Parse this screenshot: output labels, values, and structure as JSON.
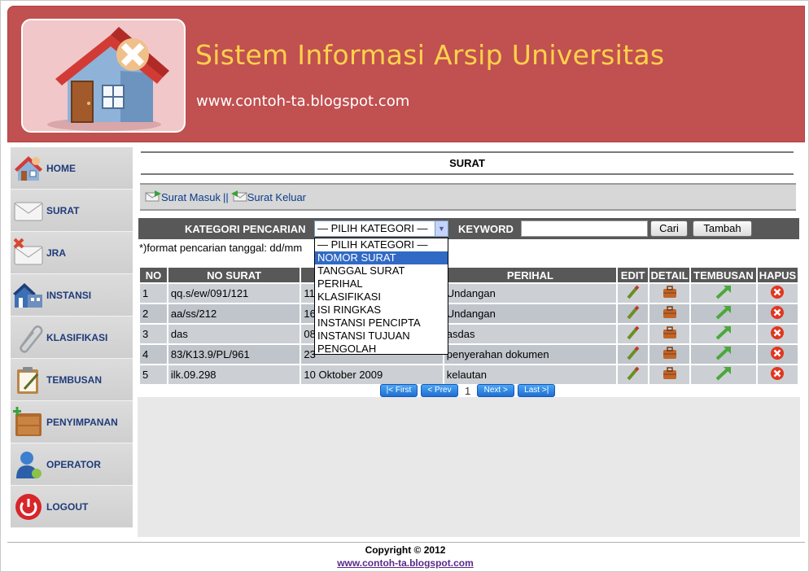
{
  "header": {
    "title": "Sistem Informasi Arsip Universitas",
    "url": "www.contoh-ta.blogspot.com"
  },
  "sidebar": {
    "items": [
      {
        "label": "HOME",
        "icon": "house-icon"
      },
      {
        "label": "SURAT",
        "icon": "envelope-icon"
      },
      {
        "label": "JRA",
        "icon": "envelope-delete-icon"
      },
      {
        "label": "INSTANSI",
        "icon": "building-icon"
      },
      {
        "label": "KLASIFIKASI",
        "icon": "paperclip-icon"
      },
      {
        "label": "TEMBUSAN",
        "icon": "clipboard-icon"
      },
      {
        "label": "PENYIMPANAN",
        "icon": "cabinet-icon"
      },
      {
        "label": "OPERATOR",
        "icon": "user-icon"
      },
      {
        "label": "LOGOUT",
        "icon": "power-icon"
      }
    ]
  },
  "main": {
    "page_title": "SURAT",
    "links": {
      "surat_masuk": "Surat Masuk",
      "separator": "||",
      "surat_keluar": "Surat Keluar"
    },
    "search": {
      "kategori_label": "KATEGORI PENCARIAN",
      "kategori_selected": "— PILIH KATEGORI —",
      "keyword_label": "KEYWORD",
      "keyword_value": "",
      "cari_button": "Cari",
      "tambah_button": "Tambah"
    },
    "format_hint": "*)format pencarian tanggal: dd/mm",
    "dropdown_options": [
      "— PILIH KATEGORI —",
      "NOMOR SURAT",
      "TANGGAL SURAT",
      "PERIHAL",
      "KLASIFIKASI",
      "ISI RINGKAS",
      "INSTANSI PENCIPTA",
      "INSTANSI TUJUAN",
      "PENGOLAH"
    ],
    "dropdown_highlighted": "NOMOR SURAT",
    "table": {
      "headers": [
        "NO",
        "NO SURAT",
        "",
        "PERIHAL",
        "EDIT",
        "DETAIL",
        "TEMBUSAN",
        "HAPUS"
      ],
      "rows": [
        {
          "no": "1",
          "no_surat": "qq.s/ew/091/121",
          "tanggal": "11",
          "perihal": "Undangan"
        },
        {
          "no": "2",
          "no_surat": "aa/ss/212",
          "tanggal": "16",
          "perihal": "Undangan"
        },
        {
          "no": "3",
          "no_surat": "das",
          "tanggal": "08",
          "perihal": "asdas"
        },
        {
          "no": "4",
          "no_surat": "83/K13.9/PL/961",
          "tanggal": "23",
          "perihal": "penyerahan dokumen"
        },
        {
          "no": "5",
          "no_surat": "ilk.09.298",
          "tanggal": "10 Oktober 2009",
          "perihal": "kelautan"
        }
      ]
    },
    "pager": {
      "first": "First",
      "prev": "Prev",
      "page": "1",
      "next": "Next",
      "last": "Last"
    }
  },
  "footer": {
    "copyright": "Copyright © 2012",
    "link": "www.contoh-ta.blogspot.com"
  },
  "colors": {
    "header_bg": "#c15050",
    "title_color": "#ffd24a",
    "bar_dark": "#585858",
    "nav_text": "#1f3b7a",
    "link_blue": "#0a3c8c",
    "dropdown_highlight": "#316ac5"
  }
}
